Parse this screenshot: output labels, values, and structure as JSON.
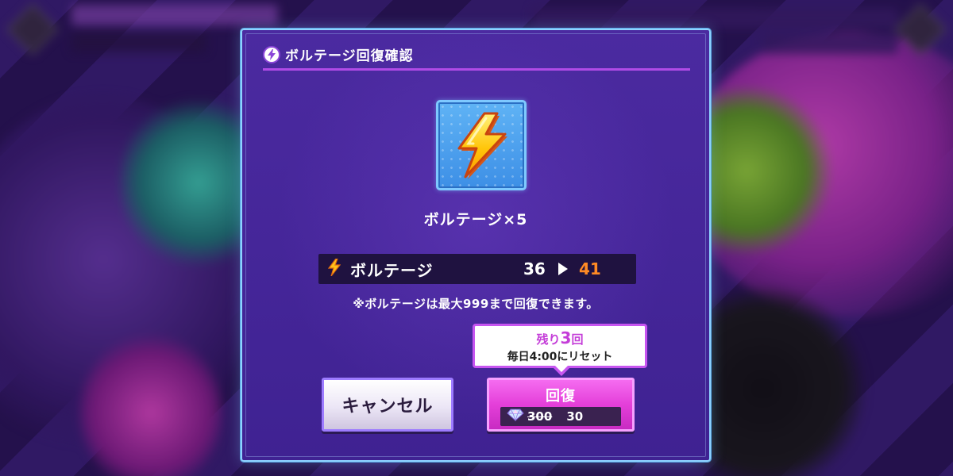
{
  "dialog": {
    "title": "ボルテージ回復確認",
    "item_name": "ボルテージ×5",
    "stat": {
      "label": "ボルテージ",
      "from": "36",
      "to": "41"
    },
    "note": "※ボルテージは最大999まで回復できます。",
    "remaining": {
      "prefix": "残り",
      "count": "3",
      "suffix": "回",
      "reset_text": "毎日4:00にリセット"
    },
    "cancel_label": "キャンセル",
    "recover_label": "回復",
    "cost": {
      "original": "300",
      "discounted": "30"
    }
  },
  "colors": {
    "accent_pink": "#e43fd9",
    "increase_orange": "#ff8a24",
    "dialog_border": "#8fd3ff",
    "dialog_bg": "#4b2aa0"
  },
  "icons": {
    "title": "voltage-bolt-icon",
    "item": "voltage-item-bolt-icon",
    "stat": "small-bolt-icon",
    "cost": "gem-icon"
  }
}
